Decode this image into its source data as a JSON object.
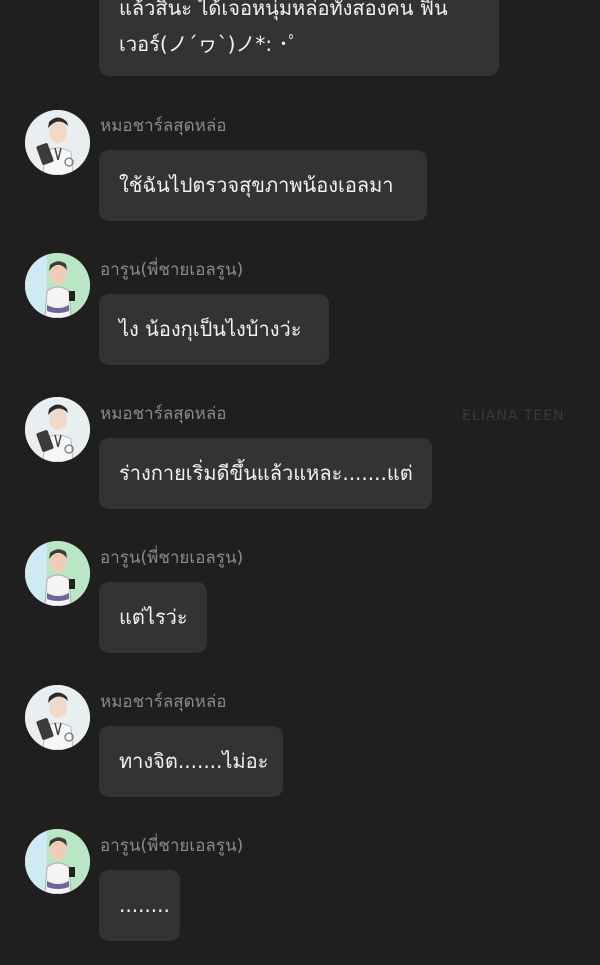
{
  "messages": [
    {
      "sender": "",
      "text": "แล้วสินะ ได้เจอหนุ่มหล่อทั้งสองคน ฟิน เวอร์(ノ´ヮ`)ノ*: ･ﾟ",
      "avatar": "none"
    },
    {
      "sender": "หมอชาร์ลสุดหล่อ",
      "text": "ใช้ฉันไปตรวจสุขภาพน้องเอลมา",
      "avatar": "doctor-avatar"
    },
    {
      "sender": "อารูน(พี่ชายเอลรูน)",
      "text": "ไง น้องกุเป็นไงบ้างว่ะ",
      "avatar": "brother-avatar"
    },
    {
      "sender": "หมอชาร์ลสุดหล่อ",
      "text": "ร่างกายเริ่มดีขึ้นแล้วแหละ.......แต่",
      "avatar": "doctor-avatar"
    },
    {
      "sender": "อารูน(พี่ชายเอลรูน)",
      "text": "แต่ไรว่ะ",
      "avatar": "brother-avatar"
    },
    {
      "sender": "หมอชาร์ลสุดหล่อ",
      "text": "ทางจิต.......ไม่อะ",
      "avatar": "doctor-avatar"
    },
    {
      "sender": "อารูน(พี่ชายเอลรูน)",
      "text": "........",
      "avatar": "brother-avatar"
    }
  ],
  "watermark": "ELIANA   TEEN"
}
